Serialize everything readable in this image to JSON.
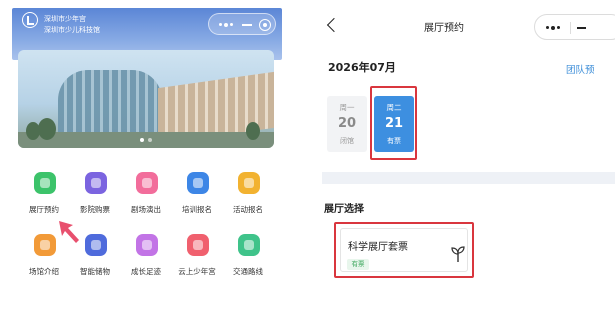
{
  "left_app": {
    "header": {
      "org_line1": "深圳市少年宫",
      "org_line2": "深圳市少儿科技馆"
    },
    "grid": {
      "items": [
        {
          "label": "展厅预约",
          "icon": "exhibit-reserve-icon",
          "color": "#3cc36a"
        },
        {
          "label": "影院购票",
          "icon": "cinema-ticket-icon",
          "color": "#7b64e0"
        },
        {
          "label": "剧场演出",
          "icon": "theater-show-icon",
          "color": "#f26d9b"
        },
        {
          "label": "培训报名",
          "icon": "training-signup-icon",
          "color": "#3d86e6"
        },
        {
          "label": "活动报名",
          "icon": "event-signup-icon",
          "color": "#f2b230"
        },
        {
          "label": "场馆介绍",
          "icon": "venue-intro-icon",
          "color": "#f29a38"
        },
        {
          "label": "智能储物",
          "icon": "smart-locker-icon",
          "color": "#4f6bdc"
        },
        {
          "label": "成长足迹",
          "icon": "growth-footprint-icon",
          "color": "#c274e6"
        },
        {
          "label": "云上少年宫",
          "icon": "cloud-palace-icon",
          "color": "#f0606e"
        },
        {
          "label": "交通路线",
          "icon": "traffic-route-icon",
          "color": "#3fc38a"
        }
      ]
    }
  },
  "right_app": {
    "nav": {
      "title": "展厅预约"
    },
    "calendar": {
      "month": "2026年07月",
      "group_link": "团队预",
      "days": [
        {
          "weekday": "周一",
          "date": "20",
          "status": "闭馆"
        },
        {
          "weekday": "周二",
          "date": "21",
          "status": "有票"
        }
      ]
    },
    "hall_section": {
      "title": "展厅选择",
      "card": {
        "name": "科学展厅套票",
        "tag": "有票"
      }
    }
  },
  "colors": {
    "accent_blue": "#3d8fe0",
    "highlight_red": "#d9363e",
    "tag_green": "#3aa65a"
  }
}
